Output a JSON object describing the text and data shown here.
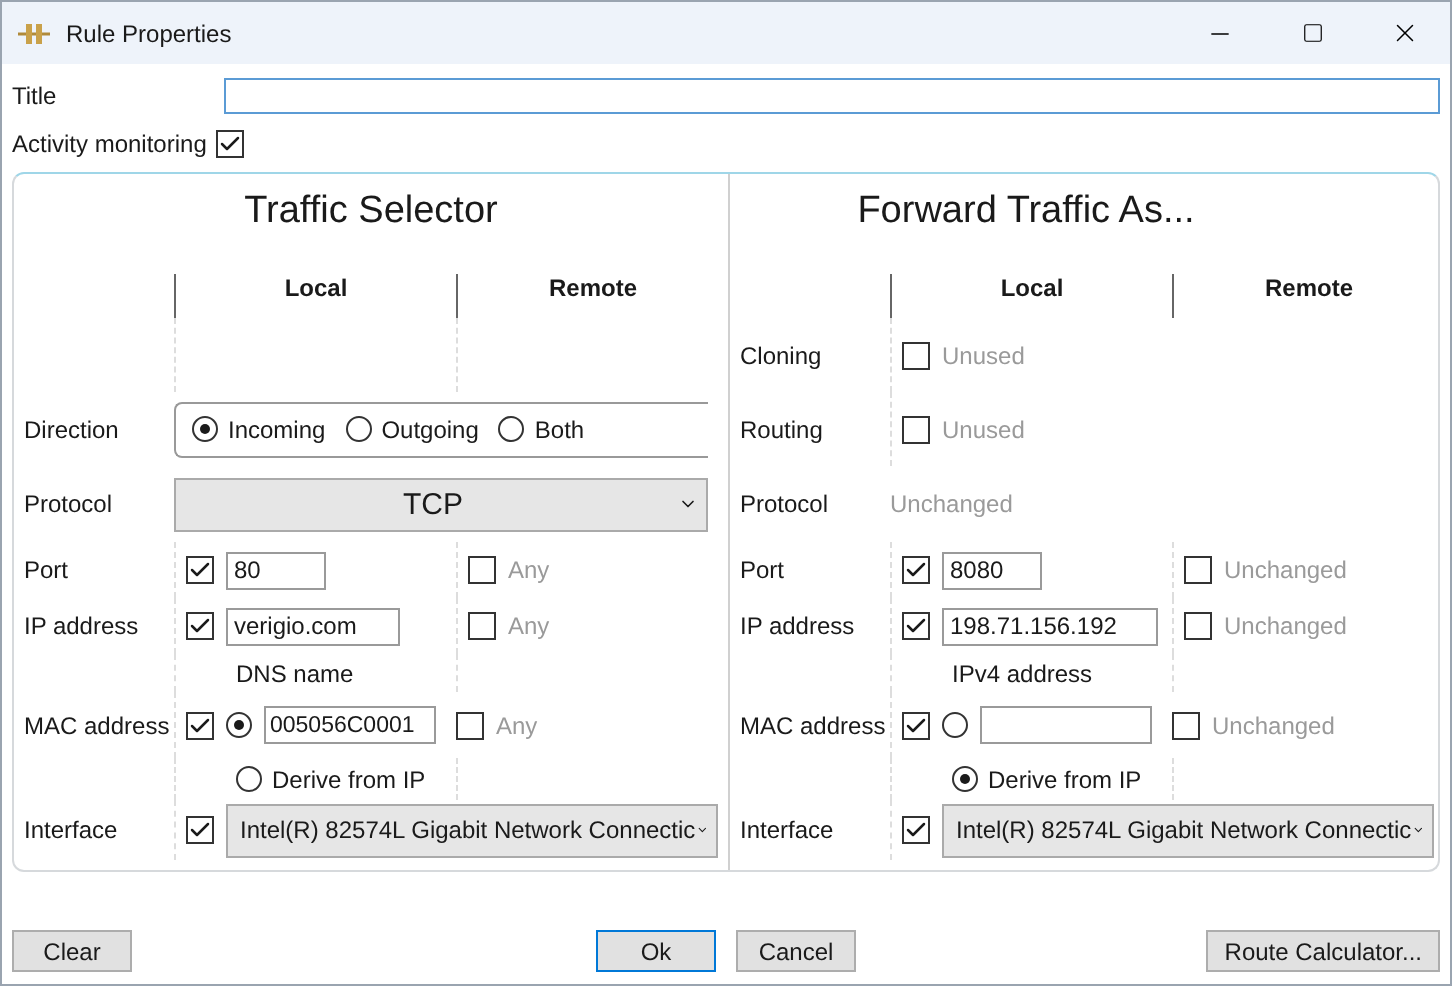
{
  "window": {
    "title": "Rule Properties"
  },
  "title_field": {
    "label": "Title"
  },
  "activity_monitoring": {
    "label": "Activity monitoring",
    "checked": true
  },
  "sections": [
    {
      "title": "Traffic Selector",
      "columns": [
        "Local",
        "Remote"
      ],
      "rows": [
        {
          "kind": "direction",
          "label": "Direction",
          "options": [
            {
              "label": "Incoming",
              "selected": true
            },
            {
              "label": "Outgoing",
              "selected": false
            },
            {
              "label": "Both",
              "selected": false
            }
          ]
        },
        {
          "kind": "select",
          "label": "Protocol",
          "value": "TCP"
        },
        {
          "kind": "field",
          "label": "Port",
          "checked": true,
          "value": "80",
          "remote": {
            "checked": false,
            "text": "Any"
          }
        },
        {
          "kind": "field",
          "label": "IP address",
          "checked": true,
          "value": "verigio.com",
          "caption": "DNS name",
          "remote": {
            "checked": false,
            "text": "Any"
          }
        },
        {
          "kind": "mac",
          "label": "MAC address",
          "checked": true,
          "value_selected": true,
          "value": "005056C0001",
          "derive": {
            "label": "Derive from IP",
            "selected": false
          },
          "remote": {
            "checked": false,
            "text": "Any"
          }
        },
        {
          "kind": "interface",
          "label": "Interface",
          "checked": true,
          "value": "Intel(R) 82574L Gigabit Network Connectic"
        }
      ]
    },
    {
      "title": "Forward Traffic As...",
      "columns": [
        "Local",
        "Remote"
      ],
      "rows": [
        {
          "kind": "toggle",
          "label": "Cloning",
          "checked": false,
          "text": "Unused"
        },
        {
          "kind": "toggle",
          "label": "Routing",
          "checked": false,
          "text": "Unused"
        },
        {
          "kind": "static",
          "label": "Protocol",
          "text": "Unchanged"
        },
        {
          "kind": "field",
          "label": "Port",
          "checked": true,
          "value": "8080",
          "remote": {
            "checked": false,
            "text": "Unchanged"
          }
        },
        {
          "kind": "field",
          "label": "IP address",
          "checked": true,
          "value": "198.71.156.192",
          "caption": "IPv4 address",
          "remote": {
            "checked": false,
            "text": "Unchanged"
          }
        },
        {
          "kind": "mac",
          "label": "MAC address",
          "checked": true,
          "value_selected": false,
          "derive": {
            "label": "Derive from IP",
            "selected": true
          },
          "remote": {
            "checked": false,
            "text": "Unchanged"
          }
        },
        {
          "kind": "interface",
          "label": "Interface",
          "checked": true,
          "value": "Intel(R) 82574L Gigabit Network Connectic"
        }
      ]
    }
  ],
  "buttons": [
    {
      "label": "Clear"
    },
    {
      "label": "Ok"
    },
    {
      "label": "Cancel"
    },
    {
      "label": "Route Calculator..."
    }
  ]
}
